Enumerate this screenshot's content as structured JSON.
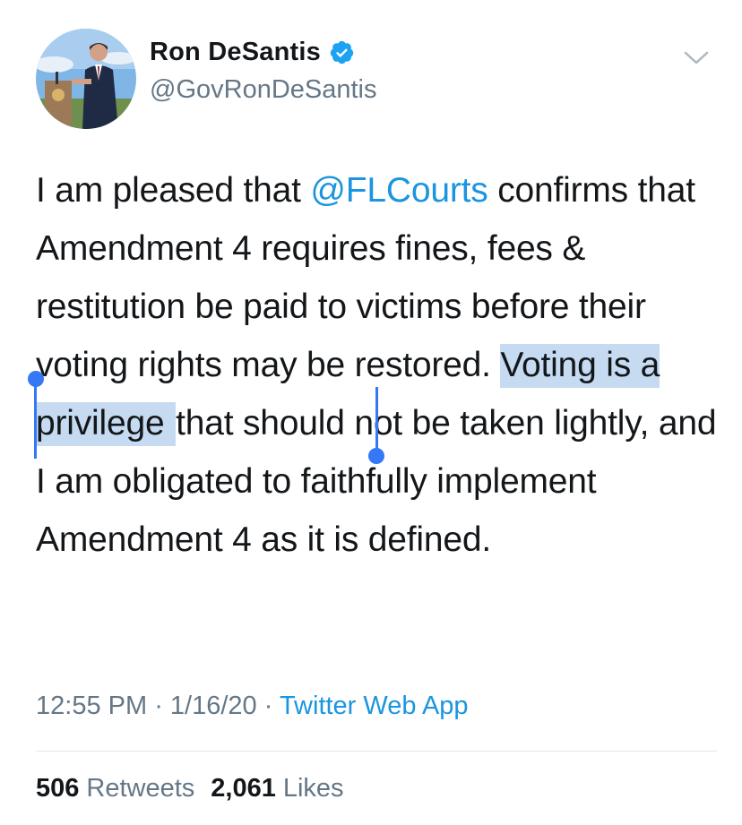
{
  "author": {
    "display_name": "Ron DeSantis",
    "handle": "@GovRonDeSantis",
    "verified": true,
    "verified_icon": "verified-badge-icon",
    "avatar_icon": "profile-photo"
  },
  "tweet": {
    "text_before_mention": "I am pleased that ",
    "mention": "@FLCourts",
    "text_after_mention": " confirms that Amendment 4 requires fines, fees & restitution be paid to victims before their voting rights may be restored. ",
    "selected_text": "Voting is a privilege ",
    "text_after_selection": "that should not be taken lightly, and I am obligated to faithfully implement Amendment 4 as it is defined."
  },
  "meta": {
    "time": "12:55 PM",
    "separator": " · ",
    "date": "1/16/20",
    "source": "Twitter Web App"
  },
  "stats": {
    "retweets_count": "506",
    "retweets_label": "Retweets",
    "likes_count": "2,061",
    "likes_label": "Likes"
  },
  "colors": {
    "link": "#1b95e0",
    "muted": "#657786",
    "text": "#14171a",
    "selection": "#c6dbf2",
    "selection_handle": "#3478f6",
    "verified": "#1da1f2"
  },
  "icons": {
    "more": "chevron-down-icon"
  }
}
